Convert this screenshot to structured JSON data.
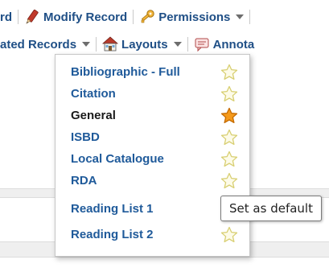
{
  "toolbar": {
    "row1": {
      "partial_left": "rd",
      "modify_record": "Modify Record",
      "permissions": "Permissions"
    },
    "row2": {
      "partial_left": "ated Records",
      "layouts": "Layouts",
      "partial_right": "Annota"
    }
  },
  "layouts_menu": {
    "items": [
      {
        "label": "Bibliographic - Full",
        "default": false
      },
      {
        "label": "Citation",
        "default": false
      },
      {
        "label": "General",
        "default": true
      },
      {
        "label": "ISBD",
        "default": false
      },
      {
        "label": "Local Catalogue",
        "default": false
      },
      {
        "label": "RDA",
        "default": false
      },
      {
        "label": "Reading List 1",
        "default": false
      },
      {
        "label": "Reading List 2",
        "default": false
      }
    ]
  },
  "tooltip": {
    "text": "Set as default"
  },
  "colors": {
    "link": "#1f5a9a",
    "active_item": "#1a1a1a",
    "star_outline": "#d8cf72",
    "star_active": "#f59a1b"
  }
}
